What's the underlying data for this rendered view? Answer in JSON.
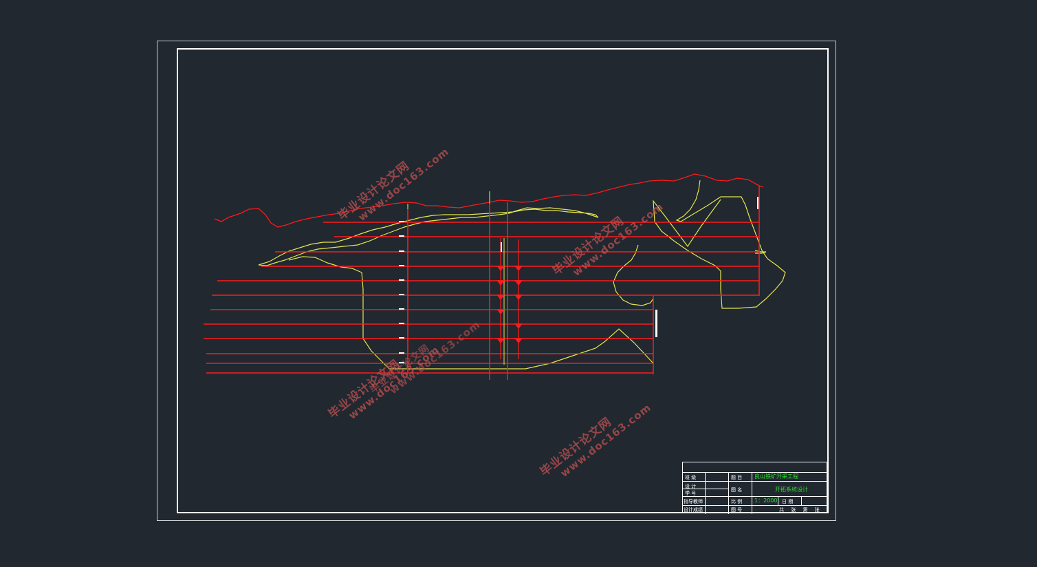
{
  "watermarks": [
    {
      "line1": "毕业设计论文网",
      "line2": "www.doc163.com"
    },
    {
      "line1": "毕业设计论文网",
      "line2": "www.doc163.com"
    },
    {
      "line1": "毕业设计论文网",
      "line2": "www.doc163.com"
    },
    {
      "line1": "毕业设计论文网",
      "line2": "www.doc163.com"
    },
    {
      "line1": "毕业设计论文网",
      "line2": "www.doc163.com"
    }
  ],
  "title_block": {
    "row_labels": [
      "班 级",
      "设 计",
      "学 号",
      "指导教师",
      "设计成绩"
    ],
    "topic_label": "题 目",
    "topic_value": "良山铁矿开采工程",
    "name_label": "图 名",
    "name_value": "开拓系统设计",
    "scale_label": "比 例",
    "scale_value": "1：2000",
    "date_label": "日 期",
    "drawing_no_label": "图 号",
    "sheets_text": "共 张 第 张"
  },
  "colors": {
    "background": "#212830",
    "levels": "#ff1a1a",
    "orebody": "#e6e64d",
    "frame": "#ffffff",
    "title_text": "#33dd33"
  }
}
